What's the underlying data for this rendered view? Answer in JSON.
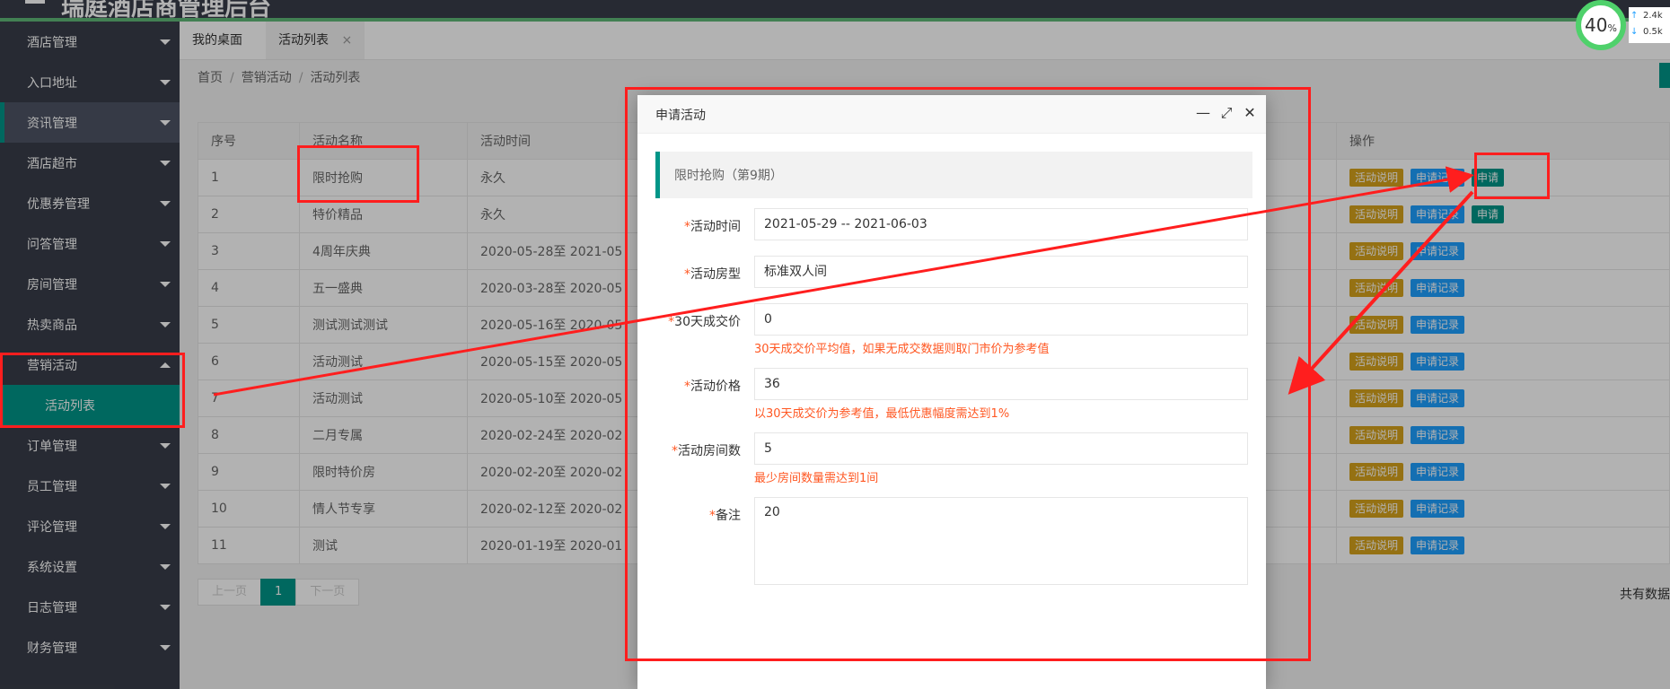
{
  "app": {
    "title": "瑞庭酒店商管理后台"
  },
  "sidebar": {
    "items": [
      {
        "label": "酒店管理"
      },
      {
        "label": "入口地址"
      },
      {
        "label": "资讯管理"
      },
      {
        "label": "酒店超市"
      },
      {
        "label": "优惠券管理"
      },
      {
        "label": "问答管理"
      },
      {
        "label": "房间管理"
      },
      {
        "label": "热卖商品"
      },
      {
        "label": "营销活动"
      },
      {
        "label": "订单管理"
      },
      {
        "label": "员工管理"
      },
      {
        "label": "评论管理"
      },
      {
        "label": "系统设置"
      },
      {
        "label": "日志管理"
      },
      {
        "label": "财务管理"
      }
    ],
    "sub_item": {
      "label": "活动列表"
    }
  },
  "tabs": [
    {
      "label": "我的桌面"
    },
    {
      "label": "活动列表",
      "close": "×"
    }
  ],
  "breadcrumb": {
    "home": "首页",
    "section": "营销活动",
    "page": "活动列表",
    "sep": "/"
  },
  "table": {
    "headers": {
      "index": "序号",
      "name": "活动名称",
      "time": "活动时间",
      "ops": "操作"
    },
    "rows": [
      {
        "index": "1",
        "name": "限时抢购",
        "time": "永久"
      },
      {
        "index": "2",
        "name": "特价精品",
        "time": "永久"
      },
      {
        "index": "3",
        "name": "4周年庆典",
        "time": "2020-05-28至 2021-05"
      },
      {
        "index": "4",
        "name": "五一盛典",
        "time": "2020-03-28至 2020-05"
      },
      {
        "index": "5",
        "name": "测试测试测试",
        "time": "2020-05-16至 2020-05"
      },
      {
        "index": "6",
        "name": "活动测试",
        "time": "2020-05-15至 2020-05"
      },
      {
        "index": "7",
        "name": "活动测试",
        "time": "2020-05-10至 2020-05"
      },
      {
        "index": "8",
        "name": "二月专属",
        "time": "2020-02-24至 2020-02"
      },
      {
        "index": "9",
        "name": "限时特价房",
        "time": "2020-02-20至 2020-02"
      },
      {
        "index": "10",
        "name": "情人节专享",
        "time": "2020-02-12至 2020-02"
      },
      {
        "index": "11",
        "name": "测试",
        "time": "2020-01-19至 2020-01"
      }
    ],
    "btn_desc": "活动说明",
    "btn_record": "申请记录",
    "btn_apply": "申请"
  },
  "pager": {
    "prev": "上一页",
    "current": "1",
    "next": "下一页",
    "total": "共有数据"
  },
  "dialog": {
    "title": "申请活动",
    "minimize": "—",
    "maximize": "⤢",
    "close": "✕",
    "quote": "限时抢购（第9期）",
    "req": "*",
    "fields": {
      "time": {
        "label": "活动时间",
        "value": "2021-05-29 -- 2021-06-03"
      },
      "room_type": {
        "label": "活动房型",
        "value": "标准双人间"
      },
      "avg_price": {
        "label": "30天成交价",
        "value": "0",
        "hint": "30天成交价平均值，如果无成交数据则取门市价为参考值"
      },
      "price": {
        "label": "活动价格",
        "value": "36",
        "hint": "以30天成交价为参考值，最低优惠幅度需达到1%"
      },
      "rooms": {
        "label": "活动房间数",
        "value": "5",
        "hint": "最少房间数量需达到1间"
      },
      "note": {
        "label": "备注",
        "value": "20"
      }
    }
  },
  "monitor": {
    "percent": "40",
    "percent_sign": "%",
    "up": "2.4k",
    "down": "0.5k",
    "up_arrow": "↑",
    "down_arrow": "↓"
  },
  "colors": {
    "accent": "#009688",
    "sidebar": "#393d49",
    "annotation": "#ff1e1e",
    "warning": "#ff5722",
    "orange_btn": "#d6a21c",
    "blue_btn": "#1e9fff"
  }
}
